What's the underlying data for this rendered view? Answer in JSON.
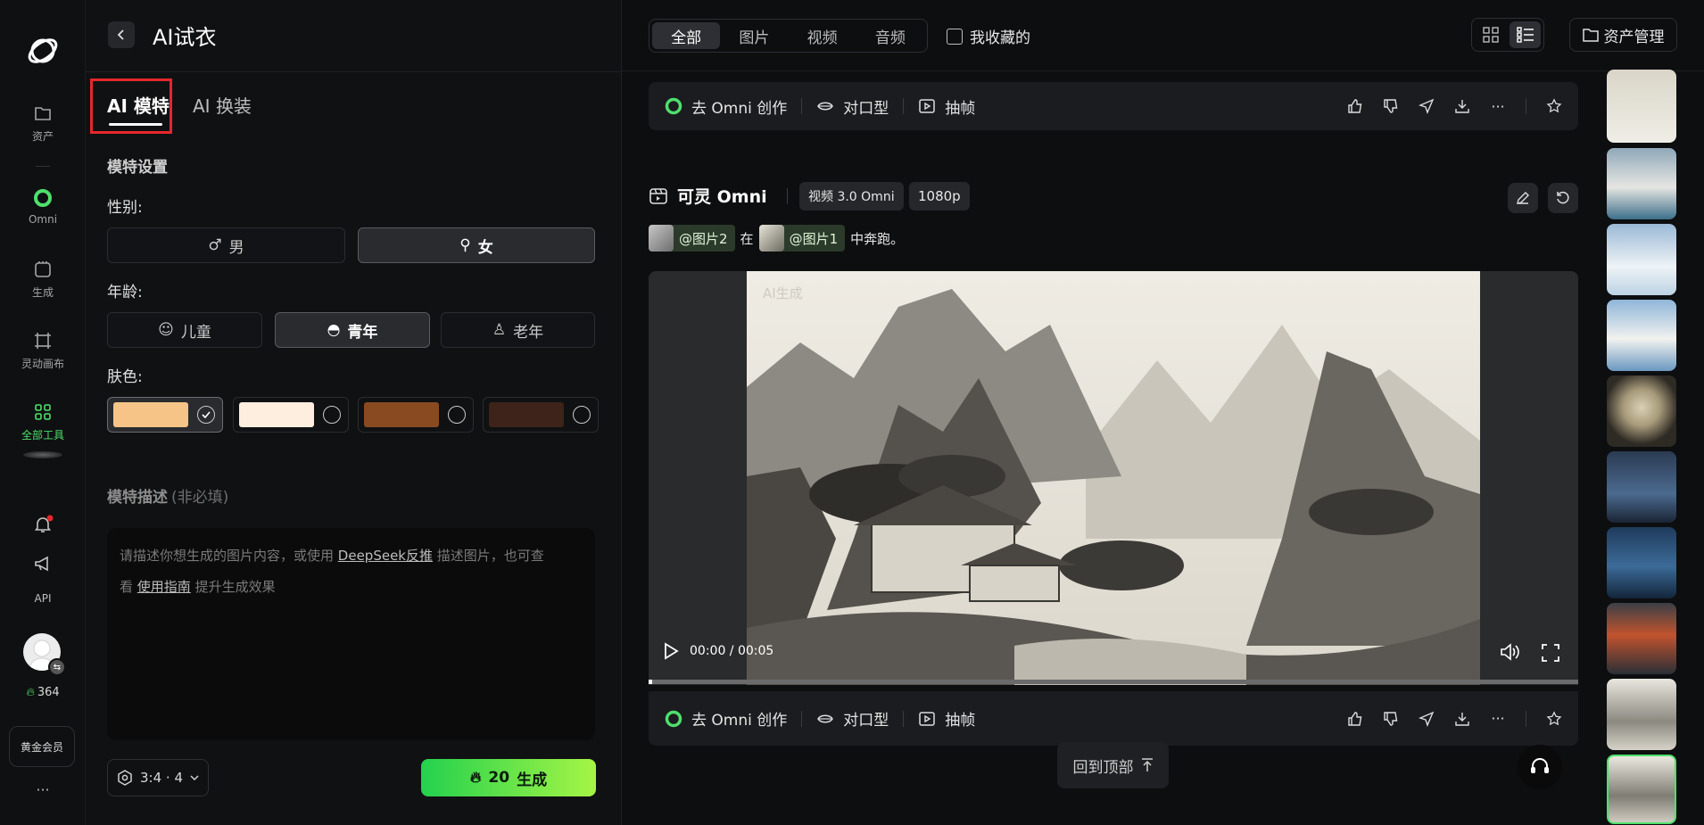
{
  "colors": {
    "accent": "#4ee06b",
    "highlight_red": "#e5272b"
  },
  "rail": {
    "logo": "app-logo-icon",
    "items": [
      {
        "label": "资产",
        "icon": "folder-icon"
      },
      {
        "label": "Omni",
        "icon": "omni-ring-icon"
      },
      {
        "label": "生成",
        "icon": "generate-icon"
      },
      {
        "label": "灵动画布",
        "icon": "canvas-icon"
      },
      {
        "label": "全部工具",
        "icon": "grid-icon"
      }
    ],
    "api": "API",
    "credits": "364",
    "membership": "黄金会员",
    "more": "···"
  },
  "panel": {
    "title": "AI试衣",
    "tabs": [
      "AI 模特",
      "AI 换装"
    ],
    "section_title": "模特设置",
    "gender_label": "性别:",
    "gender_options": [
      "男",
      "女"
    ],
    "age_label": "年龄:",
    "age_options": [
      "儿童",
      "青年",
      "老年"
    ],
    "skin_label": "肤色:",
    "skin_colors": [
      "#f7c487",
      "#fdeee0",
      "#8a4a21",
      "#3d2319"
    ],
    "desc_title": "模特描述",
    "desc_optional": "(非必填)",
    "desc_placeholder_1": "请描述你想生成的图片内容，或使用",
    "desc_link_1": "DeepSeek反推",
    "desc_placeholder_2": "描述图片，也可查",
    "desc_placeholder_3": "看",
    "desc_link_2": "使用指南",
    "desc_placeholder_4": "提升生成效果",
    "ratio": "3:4 · 4",
    "generate_cost": "20",
    "generate_label": "生成"
  },
  "topbar": {
    "tabs": [
      "全部",
      "图片",
      "视频",
      "音频"
    ],
    "favorite_label": "我收藏的",
    "asset_manage": "资产管理"
  },
  "card_actions": {
    "omni": "去 Omni 创作",
    "lipsync": "对口型",
    "frame": "抽帧"
  },
  "task": {
    "model": "可灵 Omni",
    "version_chip": "视频 3.0 Omni",
    "res_chip": "1080p",
    "prompt_ref2": "@图片2",
    "prompt_mid": "在",
    "prompt_ref1": "@图片1",
    "prompt_end": "中奔跑。"
  },
  "video": {
    "watermark": "AI生成",
    "time": "00:00 / 00:05",
    "progress": 0
  },
  "back_to_top": "回到顶部"
}
